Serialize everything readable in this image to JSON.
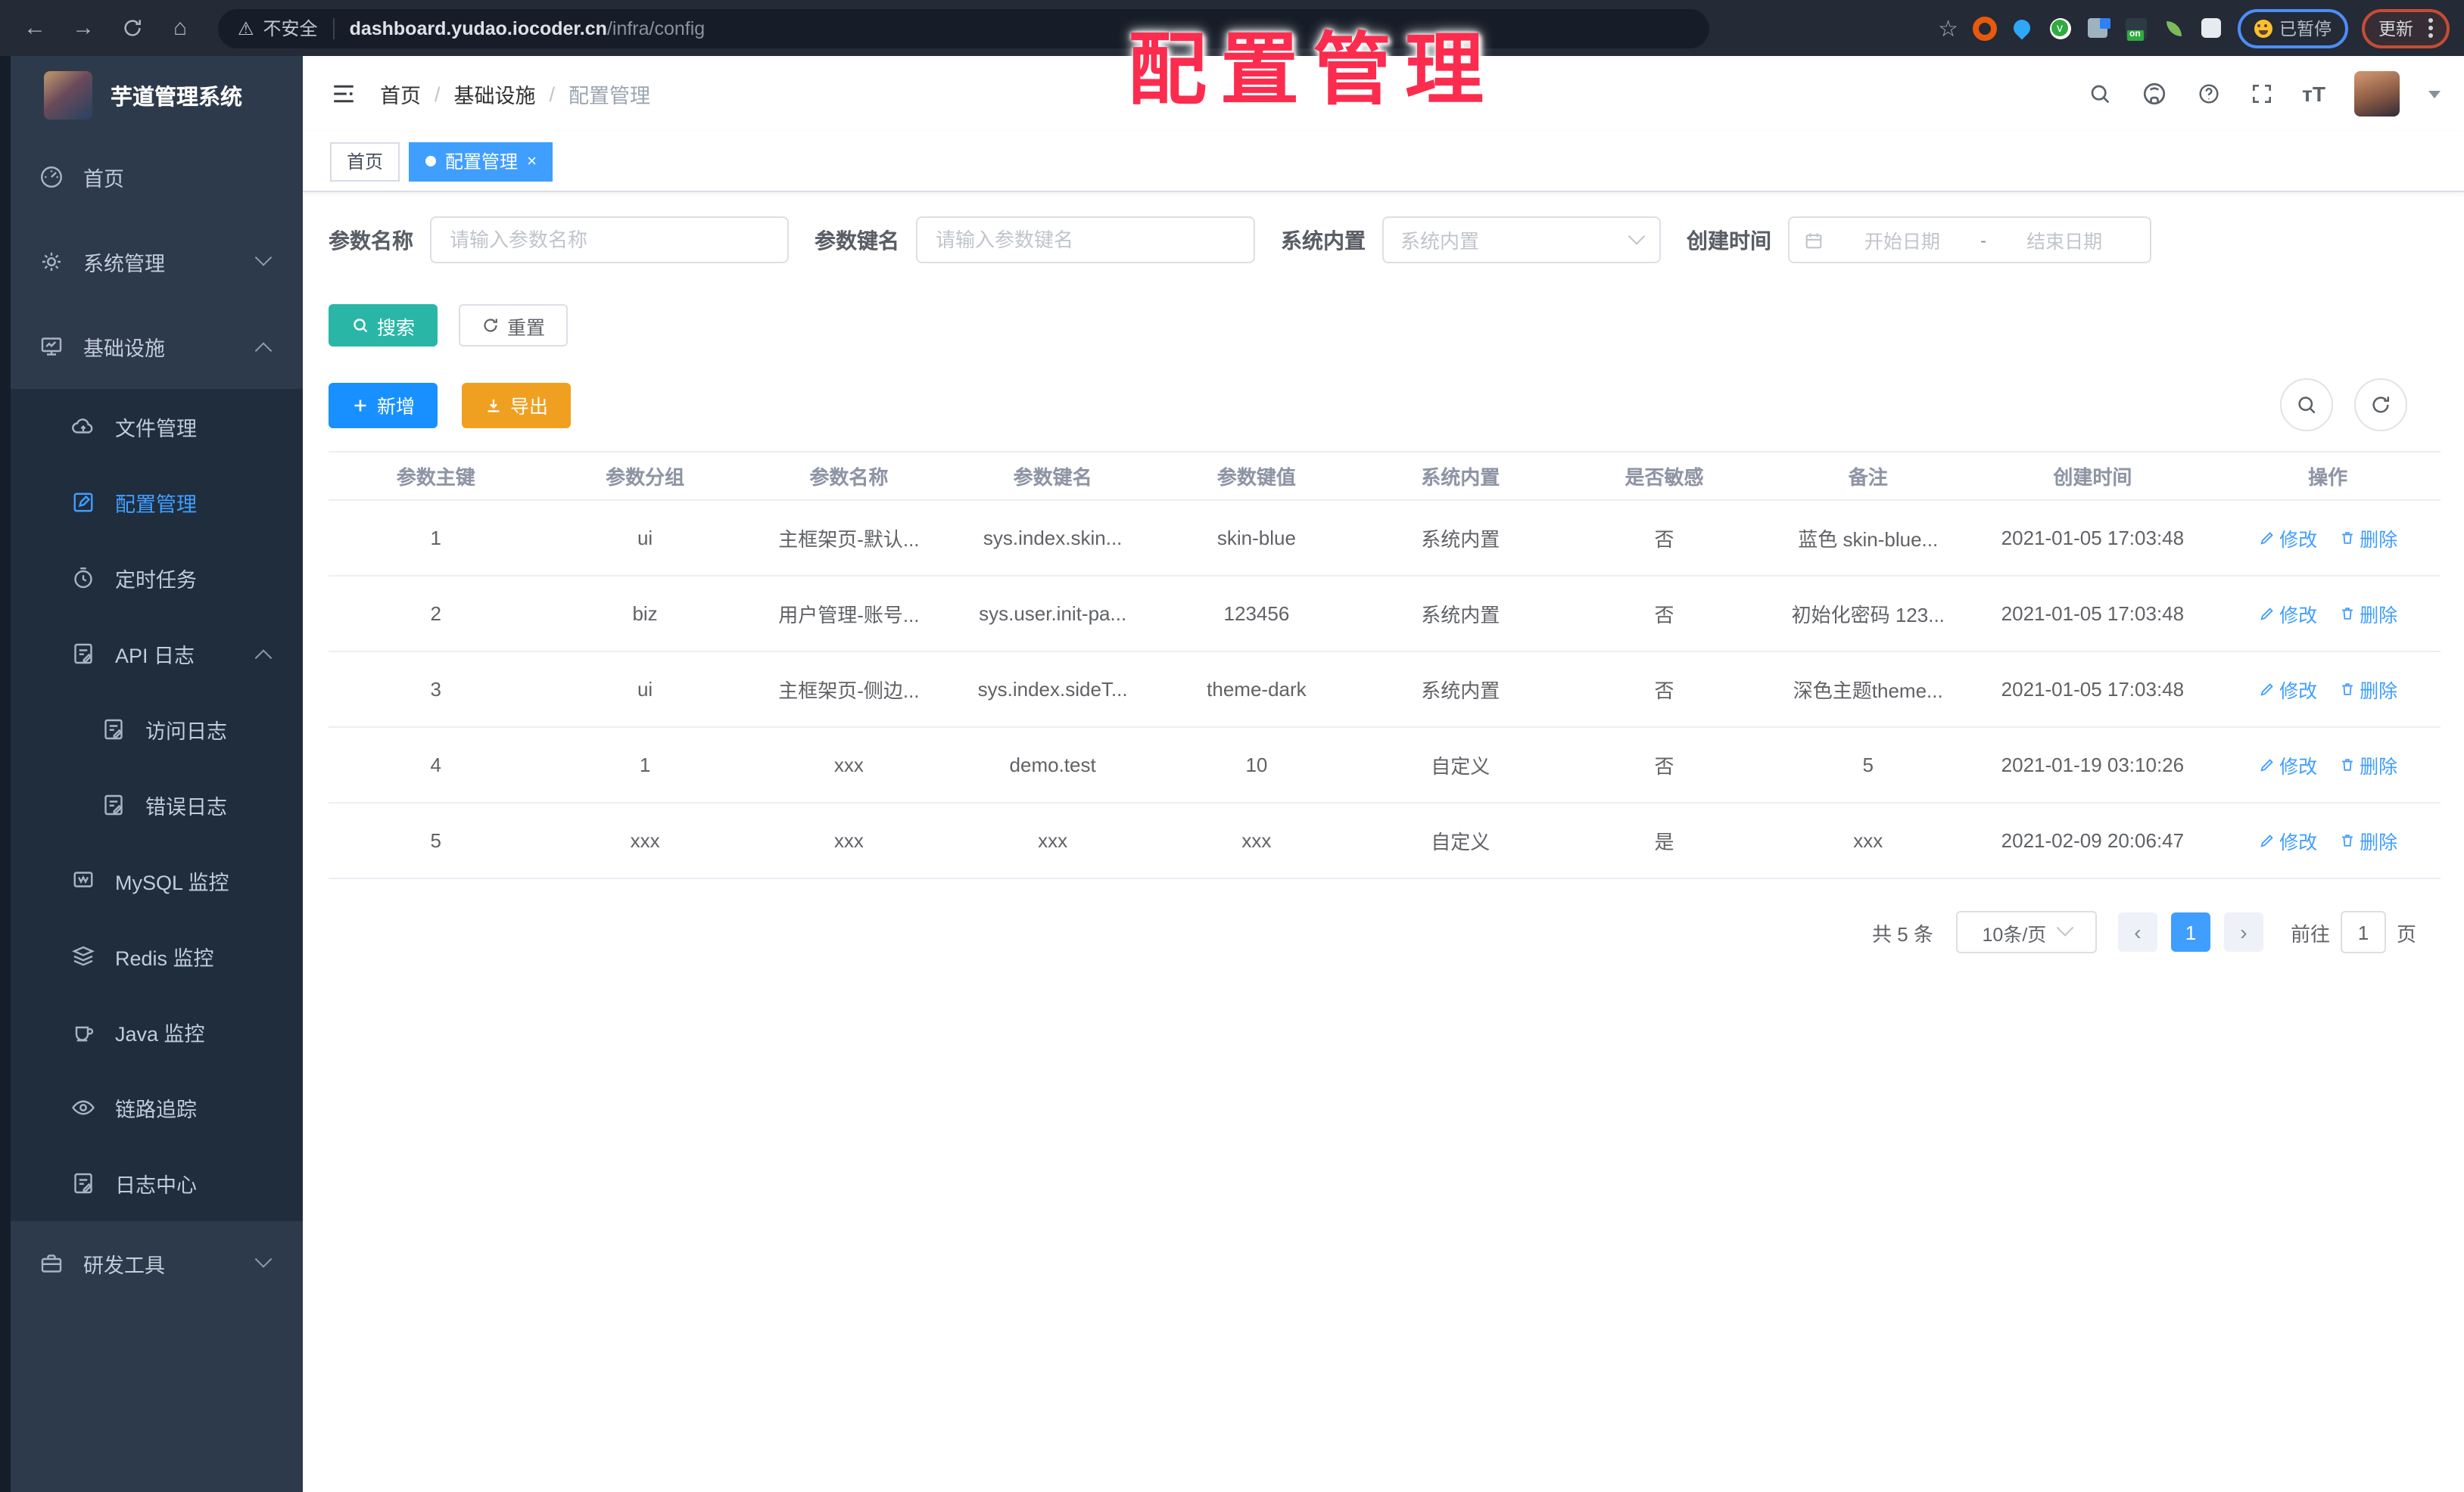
{
  "watermark": "配置管理",
  "colors": {
    "accent": "#409eff",
    "sidebar_bg": "#2d3a4b",
    "submenu_bg": "#1f2d3d",
    "search_button": "#29b6a6",
    "add_button": "#1890ff",
    "export_button": "#f0a020",
    "watermark_red": "#fb2c4e"
  },
  "browser": {
    "security": "不安全",
    "host": "dashboard.yudao.iocoder.cn",
    "path": "/infra/config",
    "paused": "已暂停",
    "update": "更新",
    "ext_badge": "on"
  },
  "sidebar": {
    "title": "芋道管理系统",
    "items": {
      "home": "首页",
      "system": "系统管理",
      "infra": "基础设施",
      "file": "文件管理",
      "config": "配置管理",
      "job": "定时任务",
      "apilog": "API 日志",
      "accesslog": "访问日志",
      "errorlog": "错误日志",
      "mysql": "MySQL 监控",
      "redis": "Redis 监控",
      "java": "Java 监控",
      "trace": "链路追踪",
      "logcenter": "日志中心",
      "tools": "研发工具"
    }
  },
  "header": {
    "breadcrumb": [
      "首页",
      "基础设施",
      "配置管理"
    ]
  },
  "tabs": {
    "home": "首页",
    "current": "配置管理"
  },
  "filters": {
    "name": {
      "label": "参数名称",
      "placeholder": "请输入参数名称"
    },
    "key": {
      "label": "参数键名",
      "placeholder": "请输入参数键名"
    },
    "type": {
      "label": "系统内置",
      "placeholder": "系统内置"
    },
    "date": {
      "label": "创建时间",
      "start": "开始日期",
      "separator": "-",
      "end": "结束日期"
    }
  },
  "toolbar": {
    "search": "搜索",
    "reset": "重置",
    "add": "新增",
    "export": "导出"
  },
  "table": {
    "columns": [
      "参数主键",
      "参数分组",
      "参数名称",
      "参数键名",
      "参数键值",
      "系统内置",
      "是否敏感",
      "备注",
      "创建时间",
      "操作"
    ],
    "rows": [
      [
        "1",
        "ui",
        "主框架页-默认...",
        "sys.index.skin...",
        "skin-blue",
        "系统内置",
        "否",
        "蓝色 skin-blue...",
        "2021-01-05 17:03:48"
      ],
      [
        "2",
        "biz",
        "用户管理-账号...",
        "sys.user.init-pa...",
        "123456",
        "系统内置",
        "否",
        "初始化密码 123...",
        "2021-01-05 17:03:48"
      ],
      [
        "3",
        "ui",
        "主框架页-侧边...",
        "sys.index.sideT...",
        "theme-dark",
        "系统内置",
        "否",
        "深色主题theme...",
        "2021-01-05 17:03:48"
      ],
      [
        "4",
        "1",
        "xxx",
        "demo.test",
        "10",
        "自定义",
        "否",
        "5",
        "2021-01-19 03:10:26"
      ],
      [
        "5",
        "xxx",
        "xxx",
        "xxx",
        "xxx",
        "自定义",
        "是",
        "xxx",
        "2021-02-09 20:06:47"
      ]
    ],
    "actions": {
      "edit": "修改",
      "delete": "删除"
    }
  },
  "pagination": {
    "total": "共 5 条",
    "size": "10条/页",
    "prev": "‹",
    "next": "›",
    "page": "1",
    "goto": "前往",
    "unit": "页"
  }
}
